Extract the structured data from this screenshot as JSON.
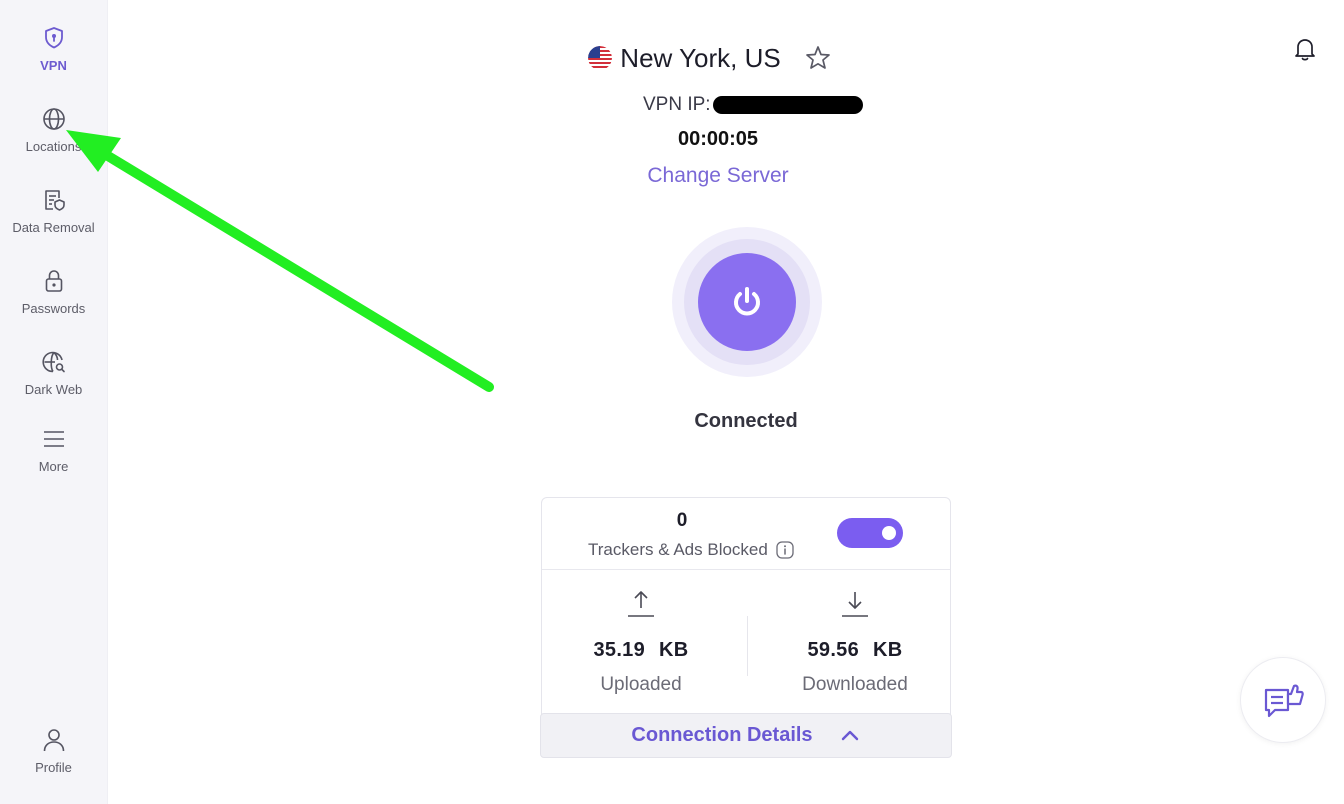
{
  "sidebar": {
    "items": [
      {
        "label": "VPN",
        "icon": "shield-lock-icon",
        "active": true
      },
      {
        "label": "Locations",
        "icon": "globe-icon",
        "active": false
      },
      {
        "label": "Data Removal",
        "icon": "document-shield-icon",
        "active": false
      },
      {
        "label": "Passwords",
        "icon": "padlock-icon",
        "active": false
      },
      {
        "label": "Dark Web",
        "icon": "globe-search-icon",
        "active": false
      },
      {
        "label": "More",
        "icon": "menu-lines-icon",
        "active": false
      }
    ],
    "profile": {
      "label": "Profile",
      "icon": "person-icon"
    }
  },
  "header": {
    "location": "New York, US",
    "flag": "us-flag-icon",
    "ip_label": "VPN IP:",
    "timer": "00:00:05",
    "change_server": "Change Server"
  },
  "connection": {
    "status": "Connected",
    "accent": "#8a6ff0"
  },
  "stats": {
    "trackers_count": "0",
    "trackers_label": "Trackers & Ads Blocked",
    "tracker_blocking_enabled": true,
    "uploaded": {
      "value": "35.19",
      "unit": "KB",
      "label": "Uploaded"
    },
    "downloaded": {
      "value": "59.56",
      "unit": "KB",
      "label": "Downloaded"
    },
    "details_label": "Connection Details"
  },
  "annotation": {
    "arrow_color": "#22ee22"
  }
}
